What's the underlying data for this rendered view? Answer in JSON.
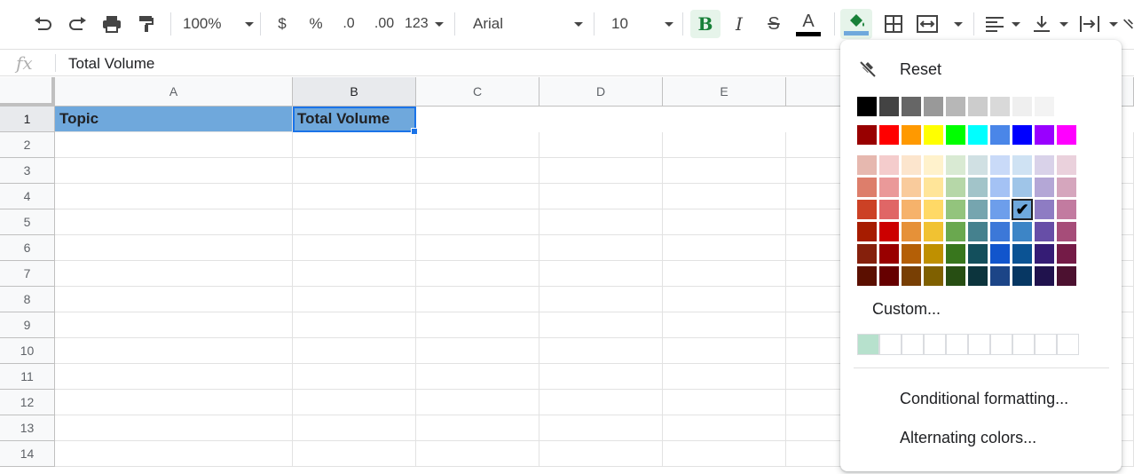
{
  "toolbar": {
    "zoom": "100%",
    "currency": "$",
    "percent": "%",
    "dec_decrease": ".0",
    "dec_increase": ".00",
    "more_formats": "123",
    "font": "Arial",
    "font_size": "10",
    "bold": "B",
    "italic": "I",
    "strike": "S",
    "text_color": "A"
  },
  "formula_bar": {
    "fx": "fx",
    "content": "Total Volume"
  },
  "grid": {
    "columns": [
      "A",
      "B",
      "C",
      "D",
      "E"
    ],
    "rows": [
      "1",
      "2",
      "3",
      "4",
      "5",
      "6",
      "7",
      "8",
      "9",
      "10",
      "11",
      "12",
      "13",
      "14"
    ],
    "cells": {
      "A1": "Topic",
      "B1": "Total Volume"
    },
    "fill_color": "#6fa8dc",
    "selection_color": "#1a73e8"
  },
  "color_menu": {
    "reset_label": "Reset",
    "custom_label": "Custom...",
    "conditional_label": "Conditional formatting...",
    "alternating_label": "Alternating colors...",
    "grays": [
      "#000000",
      "#434343",
      "#666666",
      "#999999",
      "#b7b7b7",
      "#cccccc",
      "#d9d9d9",
      "#efefef",
      "#f3f3f3",
      "#ffffff"
    ],
    "brights": [
      "#980000",
      "#ff0000",
      "#ff9900",
      "#ffff00",
      "#00ff00",
      "#00ffff",
      "#4a86e8",
      "#0000ff",
      "#9900ff",
      "#ff00ff"
    ],
    "shades": [
      [
        "#e6b8af",
        "#f4cccc",
        "#fce5cd",
        "#fff2cc",
        "#d9ead3",
        "#d0e0e3",
        "#c9daf8",
        "#cfe2f3",
        "#d9d2e9",
        "#ead1dc"
      ],
      [
        "#dd7e6b",
        "#ea9999",
        "#f9cb9c",
        "#ffe599",
        "#b6d7a8",
        "#a2c4c9",
        "#a4c2f4",
        "#9fc5e8",
        "#b4a7d6",
        "#d5a6bd"
      ],
      [
        "#cc4125",
        "#e06666",
        "#f6b26b",
        "#ffd966",
        "#93c47d",
        "#76a5af",
        "#6d9eeb",
        "#6fa8dc",
        "#8e7cc3",
        "#c27ba0"
      ],
      [
        "#a61c00",
        "#cc0000",
        "#e69138",
        "#f1c232",
        "#6aa84f",
        "#45818e",
        "#3c78d8",
        "#3d85c6",
        "#674ea7",
        "#a64d79"
      ],
      [
        "#85200c",
        "#990000",
        "#b45f06",
        "#bf9000",
        "#38761d",
        "#134f5c",
        "#1155cc",
        "#0b5394",
        "#351c75",
        "#741b47"
      ],
      [
        "#5b0f00",
        "#660000",
        "#783f04",
        "#7f6000",
        "#274e13",
        "#0c343d",
        "#1c4587",
        "#073763",
        "#20124d",
        "#4c1130"
      ]
    ],
    "selected_mark": "✔",
    "custom_colors": [
      "#b7e1cd",
      "#ffffff",
      "#ffffff",
      "#ffffff",
      "#ffffff",
      "#ffffff",
      "#ffffff",
      "#ffffff",
      "#ffffff",
      "#ffffff"
    ]
  }
}
